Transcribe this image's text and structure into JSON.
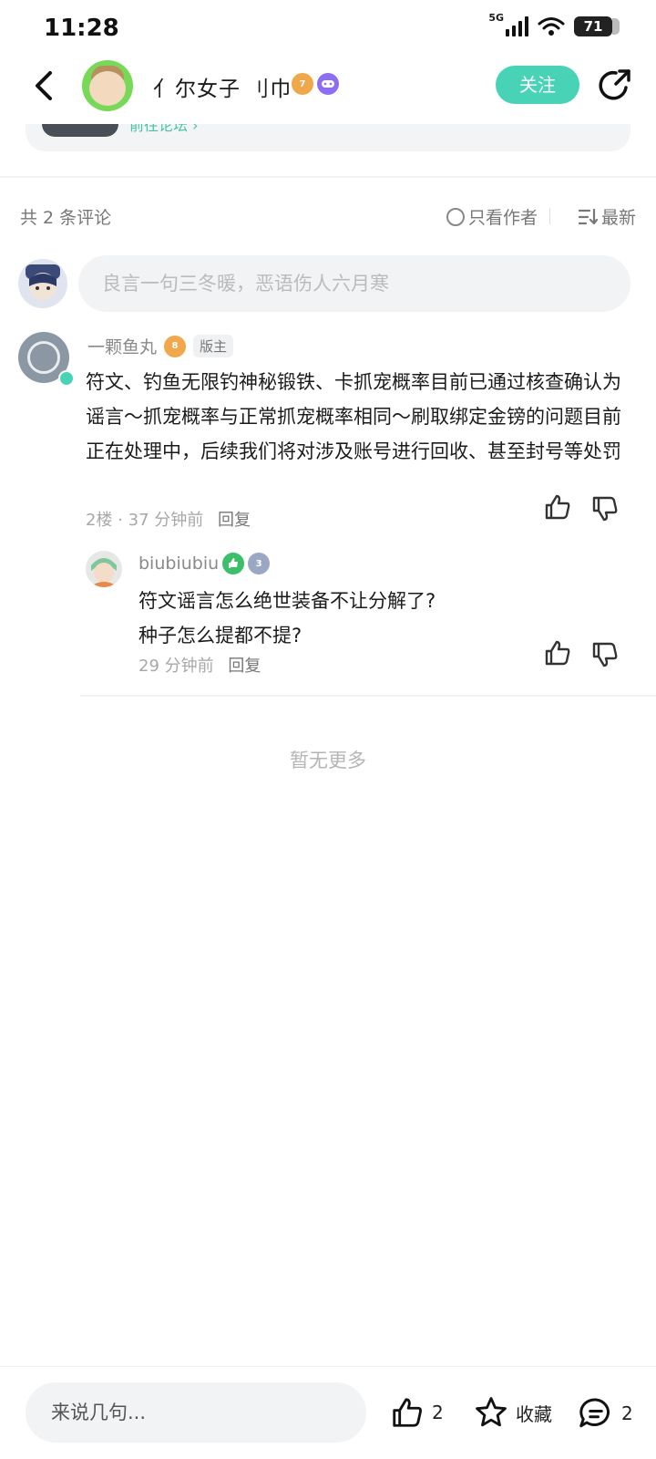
{
  "status_bar": {
    "time": "11:28",
    "network": "5G",
    "battery": "71"
  },
  "header": {
    "title": "亻尔女子 刂巾",
    "follow_label": "关注",
    "badges": {
      "level": "7"
    }
  },
  "forum_card": {
    "goto_label": "前往论坛 ›"
  },
  "comments_bar": {
    "count_label": "共 2 条评论",
    "author_only_label": "只看作者",
    "sort_label": "最新"
  },
  "compose": {
    "placeholder": "良言一句三冬暖，恶语伤人六月寒"
  },
  "comments": [
    {
      "author": "一颗鱼丸",
      "level": "8",
      "role_tag": "版主",
      "body": "符文、钓鱼无限钓神秘锻铁、卡抓宠概率目前已通过核查确认为谣言～抓宠概率与正常抓宠概率相同～刷取绑定金镑的问题目前正在处理中，后续我们将对涉及账号进行回收、甚至封号等处罚",
      "floor": "2楼 · 37 分钟前",
      "reply_label": "回复",
      "replies": [
        {
          "author": "biubiubiu",
          "level": "3",
          "body_line1": "符文谣言怎么绝世装备不让分解了?",
          "body_line2": "种子怎么提都不提?",
          "time": "29 分钟前",
          "reply_label": "回复"
        }
      ]
    }
  ],
  "no_more_label": "暂无更多",
  "bottom_bar": {
    "input_placeholder": "来说几句...",
    "like_count": "2",
    "favorite_label": "收藏",
    "comment_count": "2"
  },
  "colors": {
    "accent": "#49d3b6",
    "text_primary": "#1b1b1b",
    "text_secondary": "#8a8a8a",
    "input_bg": "#f2f3f5"
  }
}
